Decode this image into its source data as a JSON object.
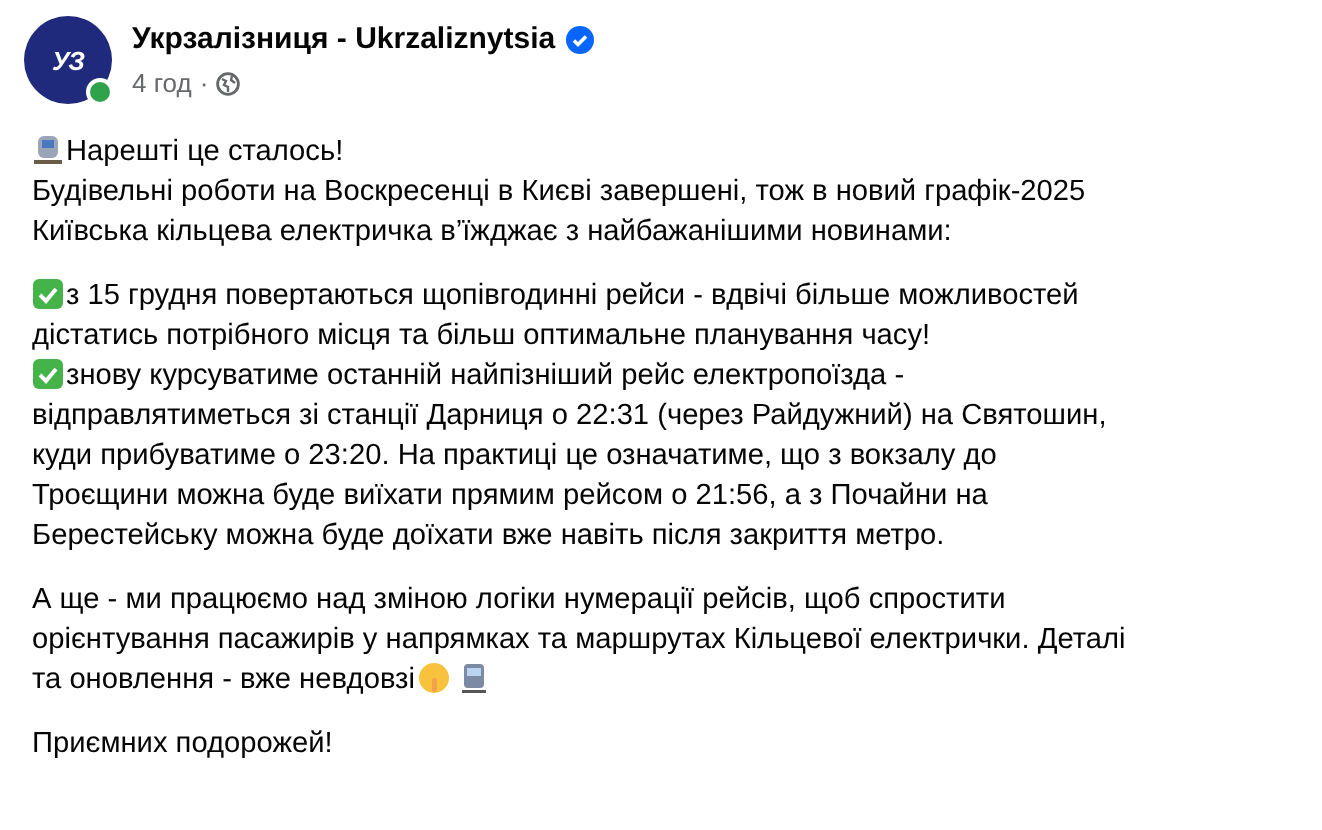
{
  "post": {
    "author": {
      "avatar_logo": "УЗ",
      "online": true,
      "name": "Укрзалізниця - Ukrzaliznytsia",
      "verified": true
    },
    "time": "4 год",
    "separator": "·",
    "paragraphs": [
      {
        "lines": [
          {
            "lead": {
              "kind": "train"
            },
            "text": "Нарешті це сталось!"
          },
          {
            "text": "Будівельні роботи на Воскресенці в Києві завершені, тож в новий графік-2025"
          },
          {
            "text": "Київська кільцева електричка в’їжджає з найбажанішими новинами:"
          }
        ]
      },
      {
        "lines": [
          {
            "lead": {
              "kind": "check"
            },
            "text": "з 15 грудня повертаються щопівгодинні рейси - вдвічі більше можливостей"
          },
          {
            "text": "дістатись потрібного місця та більш оптимальне планування часу!"
          },
          {
            "lead": {
              "kind": "check"
            },
            "text": "знову курсуватиме останній найпізніший рейс електропоїзда -"
          },
          {
            "text": "відправлятиметься зі станції Дарниця о 22:31 (через Райдужний) на Святошин,"
          },
          {
            "text": "куди прибуватиме о 23:20. На практиці це означатиме, що з вокзалу до"
          },
          {
            "text": "Троєщини можна буде виїхати прямим рейсом о 21:56, а з Почайни на"
          },
          {
            "text": "Берестейську можна буде доїхати вже навіть після закриття метро."
          }
        ]
      },
      {
        "lines": [
          {
            "text": "А ще - ми працюємо над зміною логіки нумерації рейсів, щоб спростити"
          },
          {
            "text": "орієнтування пасажирів у напрямках та маршрутах Кільцевої електрички. Деталі"
          },
          {
            "text": "та оновлення - вже невдовзі",
            "trailing": [
              {
                "kind": "shush"
              },
              {
                "kind": "metro"
              }
            ]
          }
        ]
      },
      {
        "lines": [
          {
            "text": "Приємних подорожей!"
          }
        ]
      }
    ]
  }
}
